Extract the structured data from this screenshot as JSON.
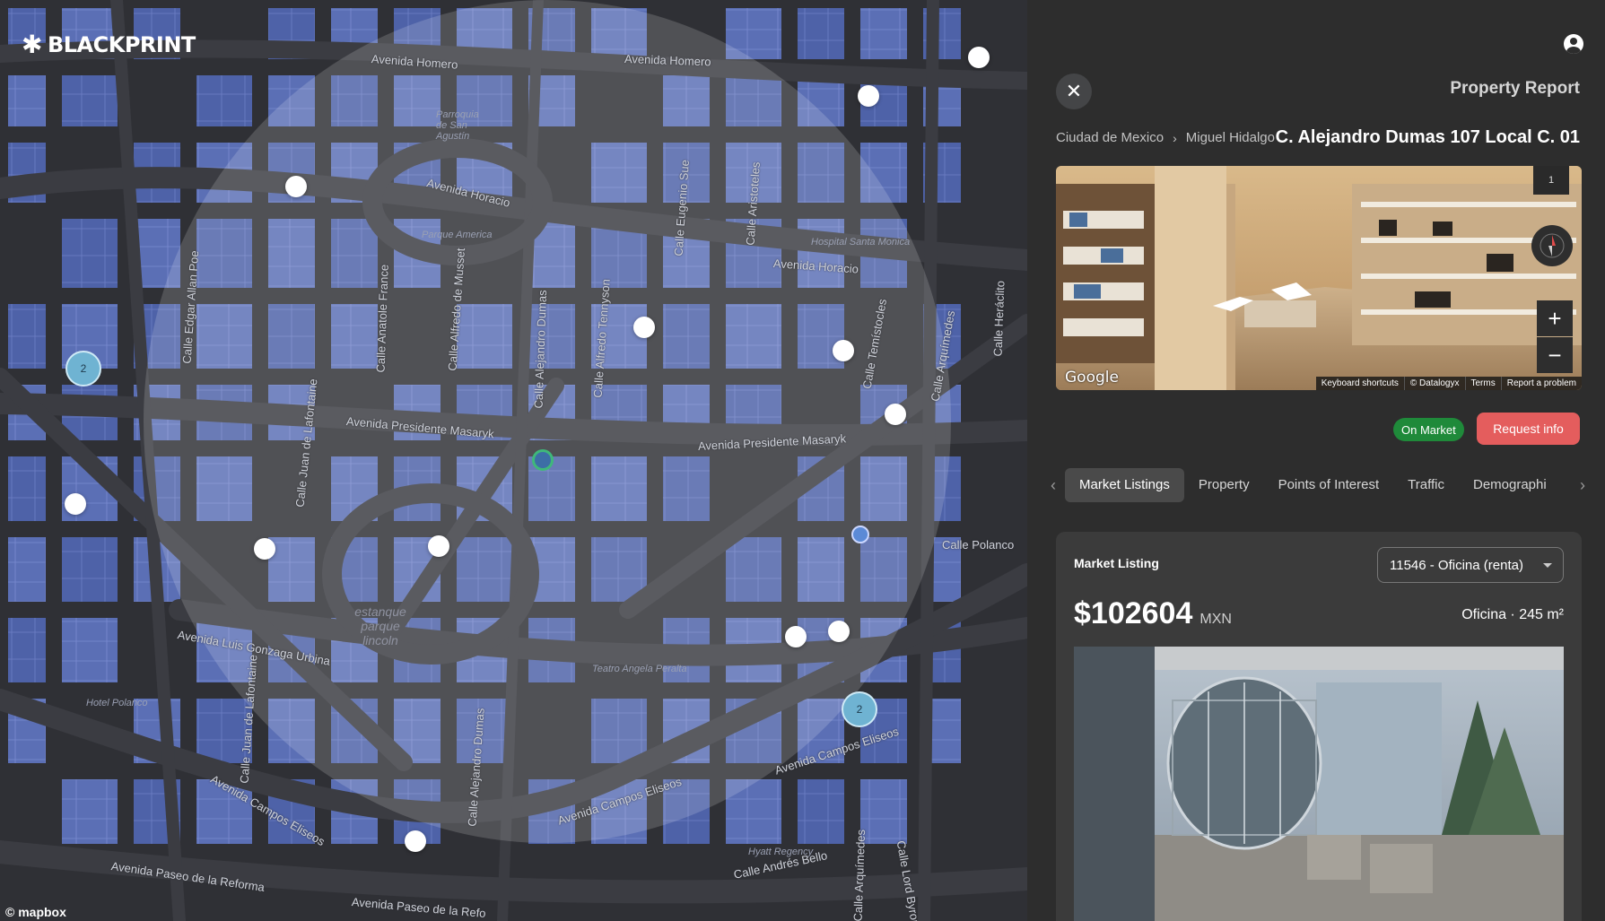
{
  "brand": {
    "name": "BLACKPRINT",
    "mark": "✱"
  },
  "map": {
    "streets": [
      "Avenida Homero",
      "Avenida Homero",
      "Avenida Horacio",
      "Avenida Horacio",
      "Avenida Presidente Masaryk",
      "Avenida Presidente Masaryk",
      "Calle Polanco",
      "Avenida Luis Gonzaga Urbina",
      "Avenida Campos Eliseos",
      "Avenida Campos Eliseos",
      "Avenida Campos Eliseos",
      "Avenida Paseo de la Reforma",
      "Avenida Paseo de la Refo",
      "Calle Andrés Bello",
      "Calle Edgar Allan Poe",
      "Calle Anatole France",
      "Calle Alfredo de Musset",
      "Calle Alejandro Dumas",
      "Calle Alfredo Tennyson",
      "Calle Eugenio Sue",
      "Calle Aristoteles",
      "Calle Temístocles",
      "Calle Arquímedes",
      "Calle Heráclito",
      "Calle Juan de Lafontaine",
      "Calle Juan de Lafontaine",
      "Calle Alejandro Dumas",
      "Calle Arquímedes",
      "Calle Lord Byron"
    ],
    "pois": [
      "Parque America",
      "estanque parque lincoln",
      "Teatro Angela Peralta",
      "Hospital Santa Monica",
      "Parroquia de San Agustín",
      "Hotel Polanco",
      "Hyatt Regency"
    ],
    "cluster_labels": [
      "2",
      "2"
    ],
    "attribution": "© mapbox"
  },
  "panel": {
    "title": "Property Report",
    "close_icon": "close-icon",
    "breadcrumb": [
      "Ciudad de Mexico",
      "Miguel Hidalgo"
    ],
    "breadcrumb_sep": "›",
    "address": "C. Alejandro Dumas 107 Local C. 01",
    "streetview": {
      "page_indicator": "1",
      "provider": "Google",
      "attribution": [
        "Keyboard shortcuts",
        "© Datalogyx",
        "Terms",
        "Report a problem"
      ],
      "zoom_in": "+",
      "zoom_out": "−"
    },
    "status_badge": "On Market",
    "request_button": "Request info",
    "tabs": [
      "Market Listings",
      "Property",
      "Points of Interest",
      "Traffic",
      "Demographi"
    ],
    "active_tab": 0,
    "listing": {
      "header": "Market Listing",
      "selected": "11546 - Oficina (renta)",
      "price": "$102604",
      "currency": "MXN",
      "meta": "Oficina · 245 m²"
    }
  }
}
